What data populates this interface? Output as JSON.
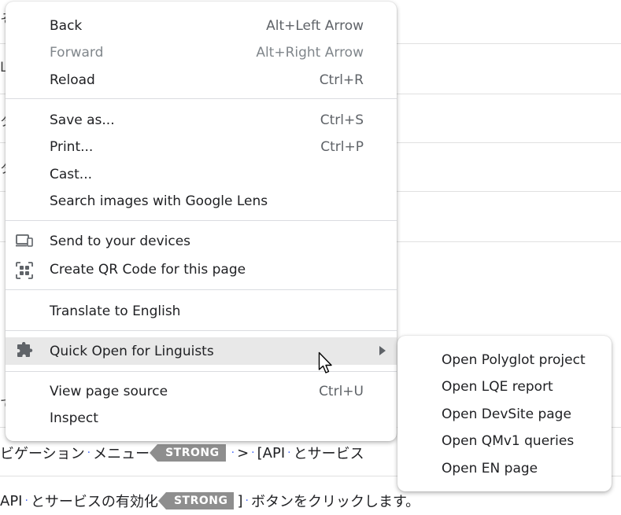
{
  "menu": {
    "items": [
      {
        "label": "Back",
        "shortcut": "Alt+Left Arrow"
      },
      {
        "label": "Forward",
        "shortcut": "Alt+Right Arrow"
      },
      {
        "label": "Reload",
        "shortcut": "Ctrl+R"
      },
      {
        "label": "Save as...",
        "shortcut": "Ctrl+S"
      },
      {
        "label": "Print...",
        "shortcut": "Ctrl+P"
      },
      {
        "label": "Cast...",
        "shortcut": ""
      },
      {
        "label": "Search images with Google Lens",
        "shortcut": ""
      },
      {
        "label": "Send to your devices",
        "icon": "devices-icon"
      },
      {
        "label": "Create QR Code for this page",
        "icon": "qr-code-icon"
      },
      {
        "label": "Translate to English"
      },
      {
        "label": "Quick Open for Linguists",
        "icon": "puzzle-extension-icon"
      },
      {
        "label": "View page source",
        "shortcut": "Ctrl+U"
      },
      {
        "label": "Inspect"
      }
    ]
  },
  "submenu": {
    "items": [
      {
        "label": "Open Polyglot project"
      },
      {
        "label": "Open LQE report"
      },
      {
        "label": "Open DevSite page"
      },
      {
        "label": "Open QMv1 queries"
      },
      {
        "label": "Open EN page"
      }
    ]
  },
  "background": {
    "line1": {
      "text_a": "ビゲーション",
      "text_b": "メニュー",
      "tag": "STRONG",
      "text_c": ">",
      "text_d": "[API",
      "text_e": "とサービス"
    },
    "line2": {
      "text_a": "API",
      "text_b": "とサービスの有効化",
      "tag": "STRONG",
      "text_c": "]",
      "text_d": "ボタンをクリックします。"
    },
    "edge_chars": [
      "そ",
      "L",
      "タ",
      "タ",
      "て"
    ]
  },
  "colors": {
    "highlight": "#e8e8e8",
    "tag_bg": "#8e8e8e",
    "dot": "#4a6cf7"
  }
}
